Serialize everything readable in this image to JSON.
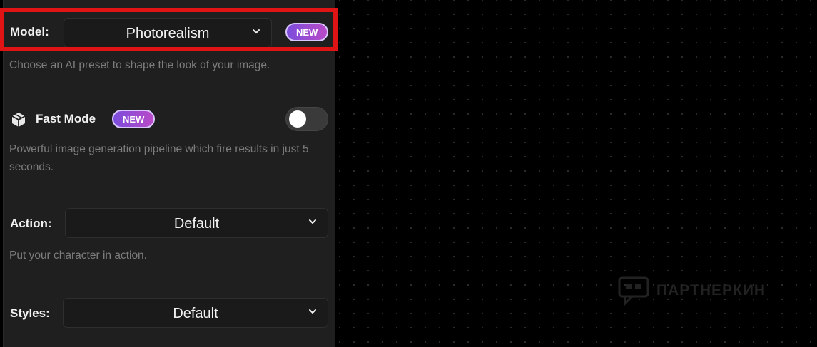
{
  "model": {
    "label": "Model:",
    "value": "Photorealism",
    "badge": "NEW",
    "description": "Choose an AI preset to shape the look of your image."
  },
  "fast_mode": {
    "label": "Fast Mode",
    "badge": "NEW",
    "enabled": false,
    "description": "Powerful image generation pipeline which fire results in just 5 seconds."
  },
  "action": {
    "label": "Action:",
    "value": "Default",
    "description": "Put your character in action."
  },
  "styles": {
    "label": "Styles:",
    "value": "Default"
  },
  "watermark": {
    "text": "ПАРТНЕРКИН"
  },
  "colors": {
    "highlight": "#e01414",
    "badge_gradient_start": "#7b4ddc",
    "badge_gradient_end": "#b94ac8"
  }
}
